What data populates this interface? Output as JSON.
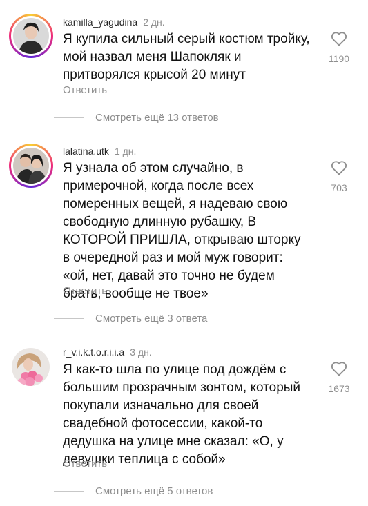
{
  "comments": [
    {
      "username": "kamilla_yagudina",
      "age": "2 дн.",
      "text": "Я купила сильный серый костюм тройку,\nмой назвал меня Шапокляк и\nпритворялся крысой 20 минут",
      "reply_label": "Ответить",
      "likes": "1190",
      "more_replies": "Смотреть ещё 13 ответов"
    },
    {
      "username": "lalatina.utk",
      "age": "1 дн.",
      "text": "Я узнала об этом случайно, в\nпримерочной, когда после всех\nпомеренных вещей, я надеваю свою\nсвободную длинную рубашку, В\nКОТОРОЙ ПРИШЛА, открываю шторку\nв очередной раз и мой муж говорит:\n«ой, нет, давай это точно не будем\nбрать, вообще не твое»",
      "reply_label": "Ответить",
      "likes": "703",
      "more_replies": "Смотреть ещё 3 ответа"
    },
    {
      "username": "r_v.i.k.t.o.r.i.i.a",
      "age": "3 дн.",
      "text": "Я как-то шла по улице под дождём с\nбольшим прозрачным зонтом, который\nпокупали изначально для своей\nсвадебной фотосессии, какой-то\nдедушка на улице мне сказал: «О, у\nдевушки теплица с собой»",
      "reply_label": "Ответить",
      "likes": "1673",
      "more_replies": "Смотреть ещё 5 ответов"
    }
  ],
  "icons": {
    "like": "heart-outline-icon"
  },
  "colors": {
    "muted": "#8e8e8e",
    "text": "#111111",
    "story_ring": "#ee2a7b"
  }
}
